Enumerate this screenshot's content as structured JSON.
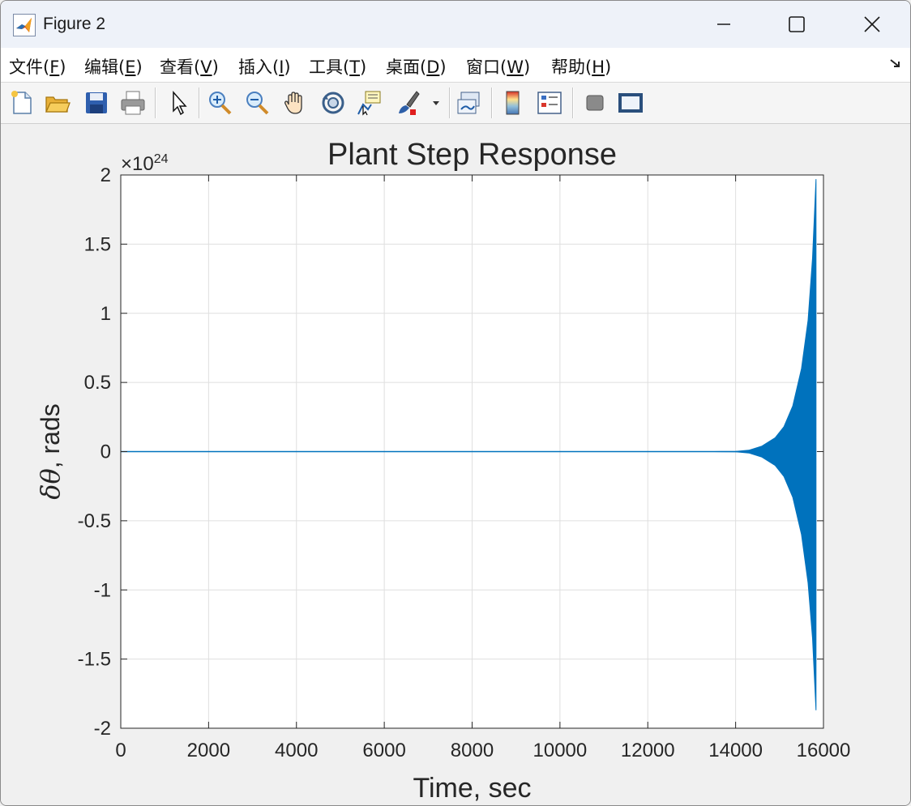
{
  "window": {
    "title": "Figure 2",
    "app_icon": "matlab-icon",
    "controls": [
      {
        "name": "minimize-button",
        "icon": "minimize-icon"
      },
      {
        "name": "maximize-button",
        "icon": "maximize-icon"
      },
      {
        "name": "close-button",
        "icon": "close-icon"
      }
    ]
  },
  "menu": {
    "items": [
      {
        "label": "文件(",
        "hotkey": "F",
        "suffix": ")"
      },
      {
        "label": "编辑(",
        "hotkey": "E",
        "suffix": ")"
      },
      {
        "label": "查看(",
        "hotkey": "V",
        "suffix": ")"
      },
      {
        "label": "插入(",
        "hotkey": "I",
        "suffix": ")"
      },
      {
        "label": "工具(",
        "hotkey": "T",
        "suffix": ")"
      },
      {
        "label": "桌面(",
        "hotkey": "D",
        "suffix": ")"
      },
      {
        "label": "窗口(",
        "hotkey": "W",
        "suffix": ")"
      },
      {
        "label": "帮助(",
        "hotkey": "H",
        "suffix": ")"
      }
    ],
    "corner_icon": "dock-arrow-icon"
  },
  "toolbar": {
    "buttons": [
      "new-figure-icon",
      "open-file-icon",
      "save-icon",
      "print-icon",
      "pointer-icon",
      "zoom-in-icon",
      "zoom-out-icon",
      "pan-hand-icon",
      "rotate-3d-icon",
      "data-cursor-icon",
      "brush-icon",
      "link-plot-icon",
      "colorbar-icon",
      "legend-icon",
      "hide-plot-tools-icon",
      "show-plot-tools-icon"
    ]
  },
  "colors": {
    "series": "#0072bd",
    "grid": "#dfdfdf",
    "axis": "#262626",
    "plot_bg": "#ffffff",
    "figure_bg": "#f0f0f0"
  },
  "chart_data": {
    "type": "line",
    "title": "Plant Step Response",
    "xlabel": "Time, sec",
    "ylabel_greek": "δθ",
    "ylabel_rest": ", rads",
    "y_exponent_base": "×10",
    "y_exponent_power": "24",
    "xlim": [
      0,
      16000
    ],
    "ylim": [
      -2,
      2
    ],
    "xticks": [
      0,
      2000,
      4000,
      6000,
      8000,
      10000,
      12000,
      14000,
      16000
    ],
    "xtick_labels": [
      "0",
      "2000",
      "4000",
      "6000",
      "8000",
      "10000",
      "12000",
      "14000",
      "16000"
    ],
    "yticks": [
      2,
      1.5,
      1,
      0.5,
      0,
      -0.5,
      -1,
      -1.5,
      -2
    ],
    "ytick_labels": [
      "2",
      "1.5",
      "1",
      "0.5",
      "0",
      "-0.5",
      "-1",
      "-1.5",
      "-2"
    ],
    "grid": true,
    "series": [
      {
        "envelope_upper": [
          [
            0,
            0
          ],
          [
            13500,
            0
          ],
          [
            14000,
            0.002
          ],
          [
            14300,
            0.01
          ],
          [
            14600,
            0.04
          ],
          [
            14900,
            0.1
          ],
          [
            15100,
            0.18
          ],
          [
            15300,
            0.33
          ],
          [
            15500,
            0.6
          ],
          [
            15650,
            0.95
          ],
          [
            15750,
            1.4
          ],
          [
            15830,
            1.97
          ]
        ],
        "envelope_lower": [
          [
            0,
            0
          ],
          [
            13500,
            0
          ],
          [
            14000,
            -0.002
          ],
          [
            14300,
            -0.01
          ],
          [
            14600,
            -0.04
          ],
          [
            14900,
            -0.1
          ],
          [
            15100,
            -0.18
          ],
          [
            15300,
            -0.33
          ],
          [
            15500,
            -0.6
          ],
          [
            15650,
            -0.95
          ],
          [
            15750,
            -1.35
          ],
          [
            15830,
            -1.87
          ]
        ]
      }
    ]
  }
}
